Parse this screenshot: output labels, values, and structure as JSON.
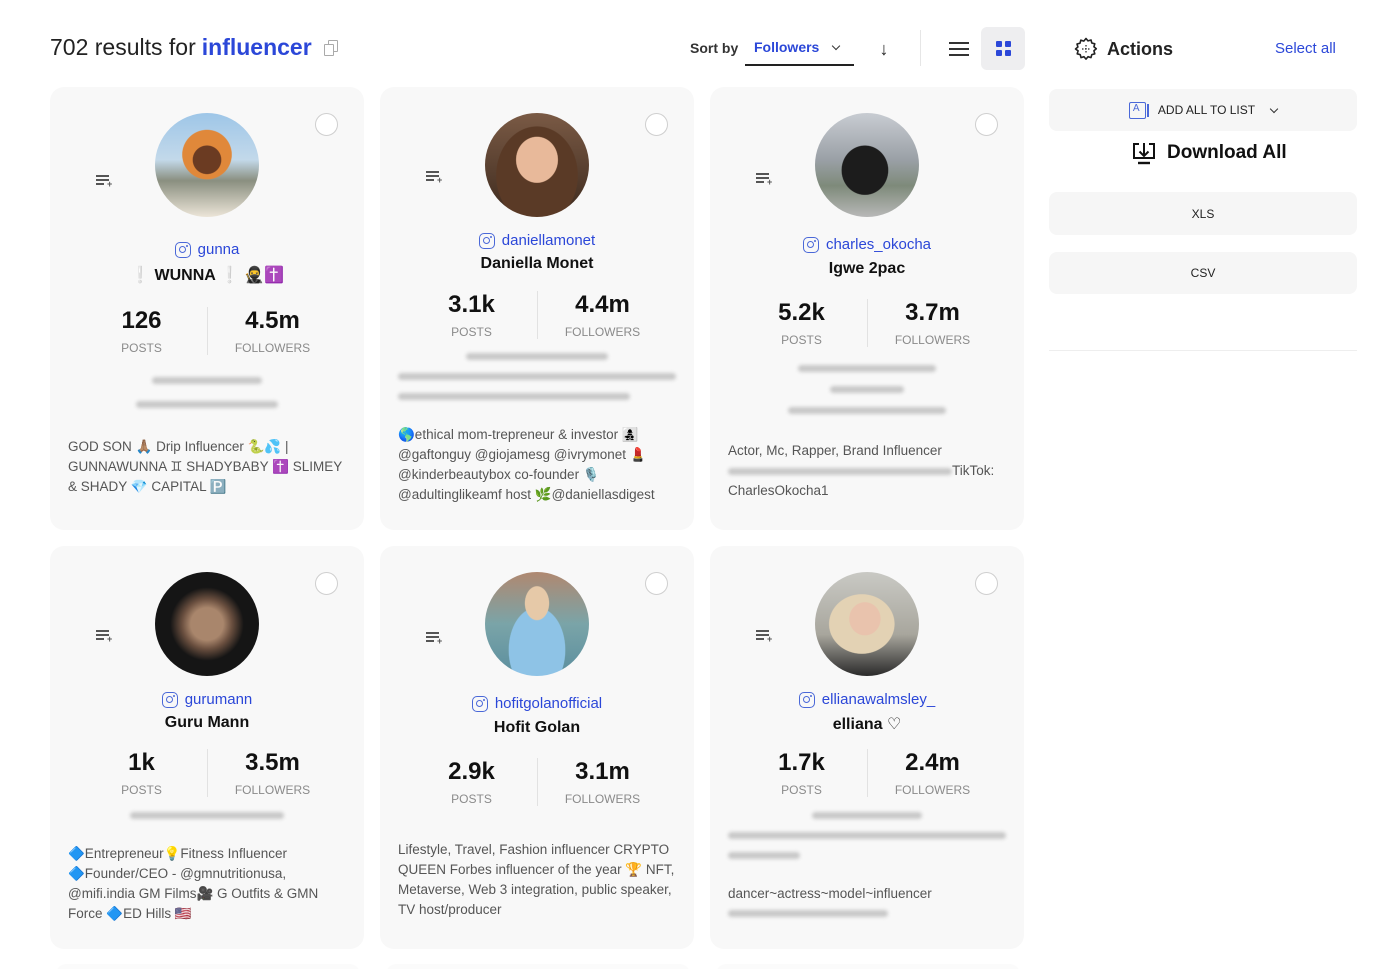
{
  "header": {
    "results_count": "702",
    "results_text": "results for",
    "query": "influencer",
    "sort_label": "Sort by",
    "sort_value": "Followers",
    "sort_direction_icon": "arrow-down-icon",
    "view_modes": [
      "list",
      "grid"
    ],
    "active_view": "grid"
  },
  "sidebar": {
    "title": "Actions",
    "select_all": "Select all",
    "add_all_to_list": "ADD ALL TO LIST",
    "download_all": "Download All",
    "formats": [
      "XLS",
      "CSV"
    ]
  },
  "colors": {
    "accent": "#2b47d8",
    "card_bg": "#f8f8f8"
  },
  "cards": [
    {
      "handle": "gunna",
      "name": "❕ WUNNA ❕ 🥷✝️",
      "posts": "126",
      "followers": "4.5m",
      "posts_label": "POSTS",
      "followers_label": "FOLLOWERS",
      "bio": "GOD SON 🙏🏽 Drip Influencer 🐍💦 | GUNNAWUNNA ♊ SHADYBABY ✝️ SLIMEY & SHADY 💎 CAPITAL 🅿️"
    },
    {
      "handle": "daniellamonet",
      "name": "Daniella Monet",
      "posts": "3.1k",
      "followers": "4.4m",
      "posts_label": "POSTS",
      "followers_label": "FOLLOWERS",
      "bio": "🌎ethical mom-trepreneur & investor 👩‍👧‍👦 @gaftonguy @giojamesg @ivrymonet 💄 @kinderbeautybox co-founder 🎙️ @adultinglikeamf host 🌿@daniellasdigest"
    },
    {
      "handle": "charles_okocha",
      "name": "Igwe 2pac",
      "posts": "5.2k",
      "followers": "3.7m",
      "posts_label": "POSTS",
      "followers_label": "FOLLOWERS",
      "bio_line1": "Actor, Mc, Rapper, Brand Influencer",
      "bio_line2": "TikTok:",
      "bio_line3": "CharlesOkocha1"
    },
    {
      "handle": "gurumann",
      "name": "Guru Mann",
      "posts": "1k",
      "followers": "3.5m",
      "posts_label": "POSTS",
      "followers_label": "FOLLOWERS",
      "bio": "🔷Entrepreneur💡Fitness Influencer 🔷Founder/CEO - @gmnutritionusa, @mifi.india GM Films🎥 G Outfits & GMN Force 🔷ED Hills 🇺🇸"
    },
    {
      "handle": "hofitgolanofficial",
      "name": "Hofit Golan",
      "posts": "2.9k",
      "followers": "3.1m",
      "posts_label": "POSTS",
      "followers_label": "FOLLOWERS",
      "bio": "Lifestyle, Travel, Fashion influencer CRYPTO QUEEN Forbes influencer of the year 🏆 NFT, Metaverse, Web 3 integration, public speaker, TV host/producer"
    },
    {
      "handle": "ellianawalmsley_",
      "name": "elliana ♡",
      "posts": "1.7k",
      "followers": "2.4m",
      "posts_label": "POSTS",
      "followers_label": "FOLLOWERS",
      "bio": "dancer~actress~model~influencer"
    }
  ]
}
